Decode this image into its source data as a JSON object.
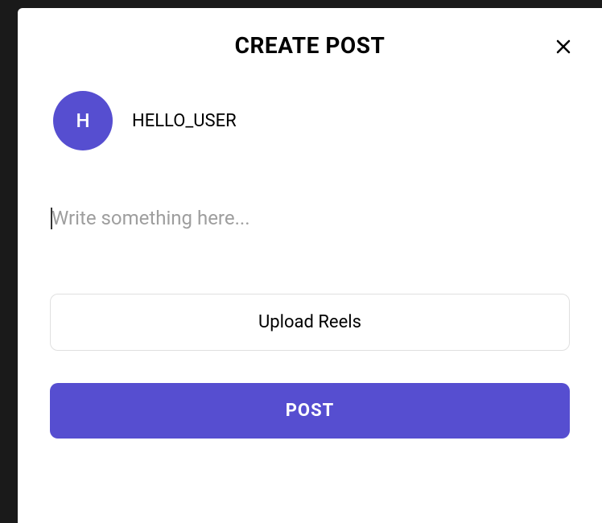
{
  "modal": {
    "title": "CREATE POST"
  },
  "user": {
    "avatar_initial": "H",
    "username": "HELLO_USER"
  },
  "input": {
    "placeholder": "Write something here...",
    "value": ""
  },
  "buttons": {
    "upload": "Upload Reels",
    "post": "POST"
  },
  "colors": {
    "primary": "#564ed0"
  }
}
